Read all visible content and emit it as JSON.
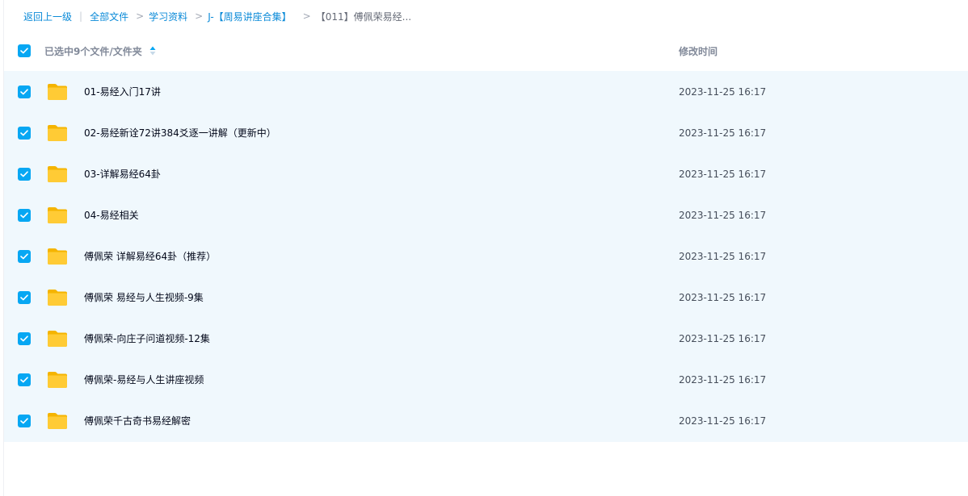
{
  "breadcrumb": {
    "back": "返回上一级",
    "separator_bar": "|",
    "items": [
      {
        "label": "全部文件"
      },
      {
        "label": "学习资料"
      },
      {
        "label": "J-【周易讲座合集】"
      }
    ],
    "separator": ">",
    "current": "【011】傅佩荣易经..."
  },
  "header": {
    "select_all_checked": true,
    "selection_label": "已选中9个文件/文件夹",
    "sort_icon": "sort-icon",
    "modified_column": "修改时间"
  },
  "files": [
    {
      "name": "01-易经入门17讲",
      "modified": "2023-11-25 16:17",
      "checked": true,
      "icon": "folder-icon"
    },
    {
      "name": "02-易经新诠72讲384爻逐一讲解（更新中）",
      "modified": "2023-11-25 16:17",
      "checked": true,
      "icon": "folder-icon"
    },
    {
      "name": "03-详解易经64卦",
      "modified": "2023-11-25 16:17",
      "checked": true,
      "icon": "folder-icon"
    },
    {
      "name": "04-易经相关",
      "modified": "2023-11-25 16:17",
      "checked": true,
      "icon": "folder-icon"
    },
    {
      "name": "傅佩荣 详解易经64卦（推荐）",
      "modified": "2023-11-25 16:17",
      "checked": true,
      "icon": "folder-icon"
    },
    {
      "name": "傅佩荣 易经与人生视频-9集",
      "modified": "2023-11-25 16:17",
      "checked": true,
      "icon": "folder-icon"
    },
    {
      "name": "傅佩荣-向庄子问道视频-12集",
      "modified": "2023-11-25 16:17",
      "checked": true,
      "icon": "folder-icon"
    },
    {
      "name": "傅佩荣-易经与人生讲座视频",
      "modified": "2023-11-25 16:17",
      "checked": true,
      "icon": "folder-icon"
    },
    {
      "name": "傅佩荣千古奇书易经解密",
      "modified": "2023-11-25 16:17",
      "checked": true,
      "icon": "folder-icon"
    }
  ],
  "colors": {
    "accent": "#07a7f3",
    "link": "#0a8ad8",
    "selected_row_bg": "#f0f8fd",
    "folder": "#ffc62e"
  }
}
